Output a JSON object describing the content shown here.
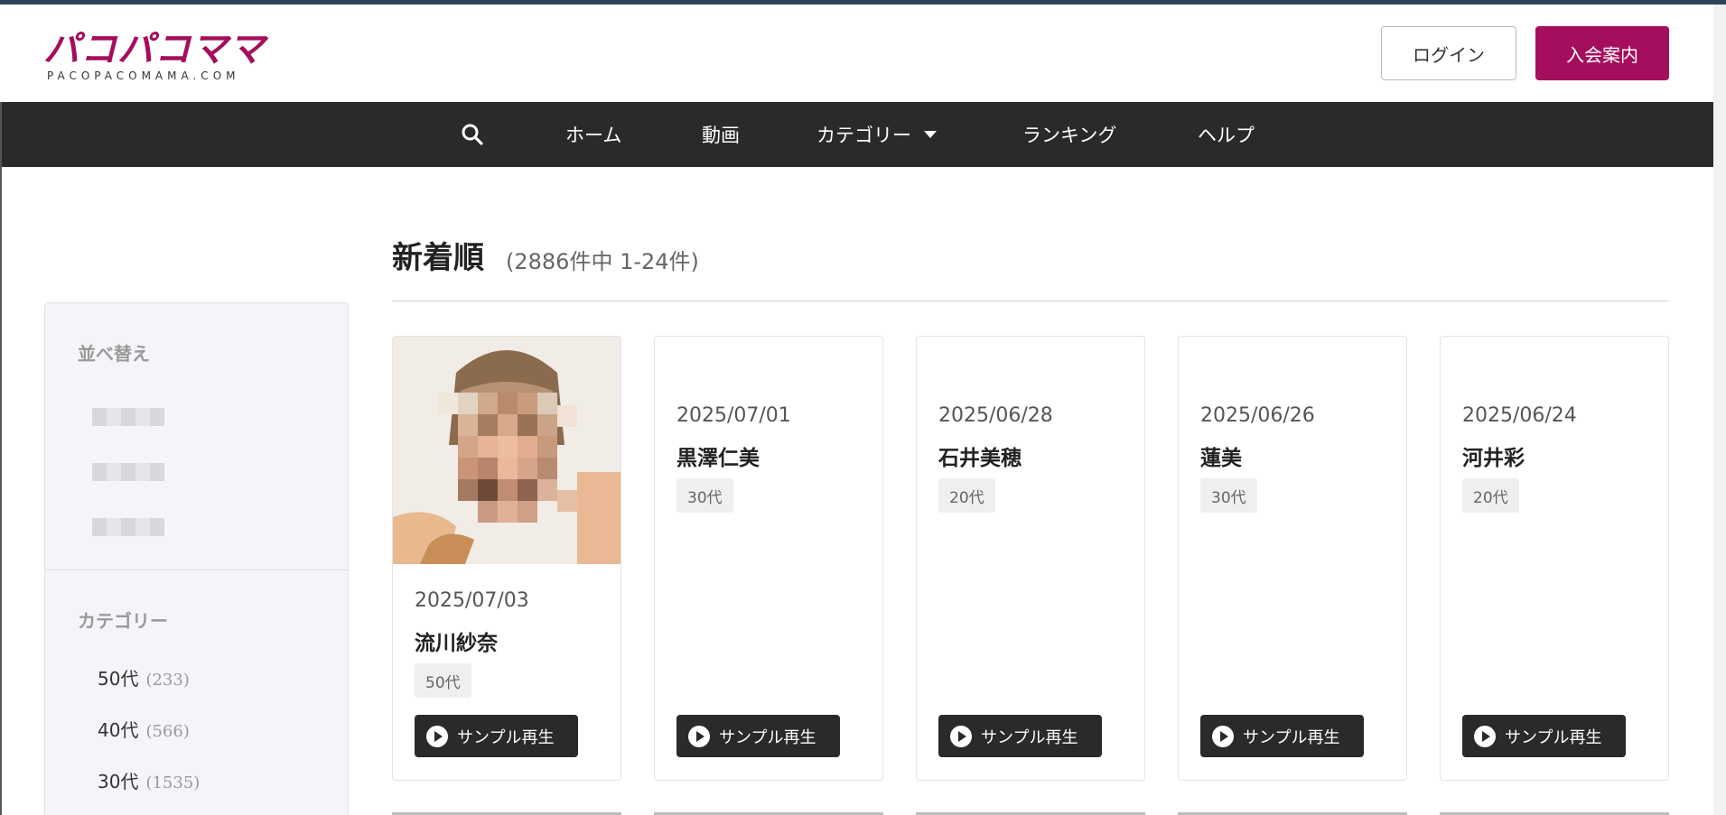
{
  "header": {
    "logo_main": "パコパコママ",
    "logo_sub": "PACOPACOMAMA.COM",
    "login_label": "ログイン",
    "join_label": "入会案内"
  },
  "nav": {
    "items": [
      {
        "label": "ホーム"
      },
      {
        "label": "動画"
      },
      {
        "label": "カテゴリー"
      },
      {
        "label": "ランキング"
      },
      {
        "label": "ヘルプ"
      }
    ]
  },
  "sidebar": {
    "sort_heading": "並べ替え",
    "category_heading": "カテゴリー",
    "categories": [
      {
        "label": "50代",
        "count": "(233)"
      },
      {
        "label": "40代",
        "count": "(566)"
      },
      {
        "label": "30代",
        "count": "(1535)"
      }
    ]
  },
  "main": {
    "title": "新着順",
    "count": "(2886件中 1-24件)",
    "sample_label": "サンプル再生",
    "cards": [
      {
        "date": "2025/07/03",
        "name": "流川紗奈",
        "tag": "50代"
      },
      {
        "date": "2025/07/01",
        "name": "黒澤仁美",
        "tag": "30代"
      },
      {
        "date": "2025/06/28",
        "name": "石井美穂",
        "tag": "20代"
      },
      {
        "date": "2025/06/26",
        "name": "蓮美",
        "tag": "30代"
      },
      {
        "date": "2025/06/24",
        "name": "河井彩",
        "tag": "20代"
      }
    ]
  },
  "colors": {
    "brand": "#a50e5c",
    "nav_bg": "#2a2a2a",
    "topbar": "#2f4257"
  }
}
